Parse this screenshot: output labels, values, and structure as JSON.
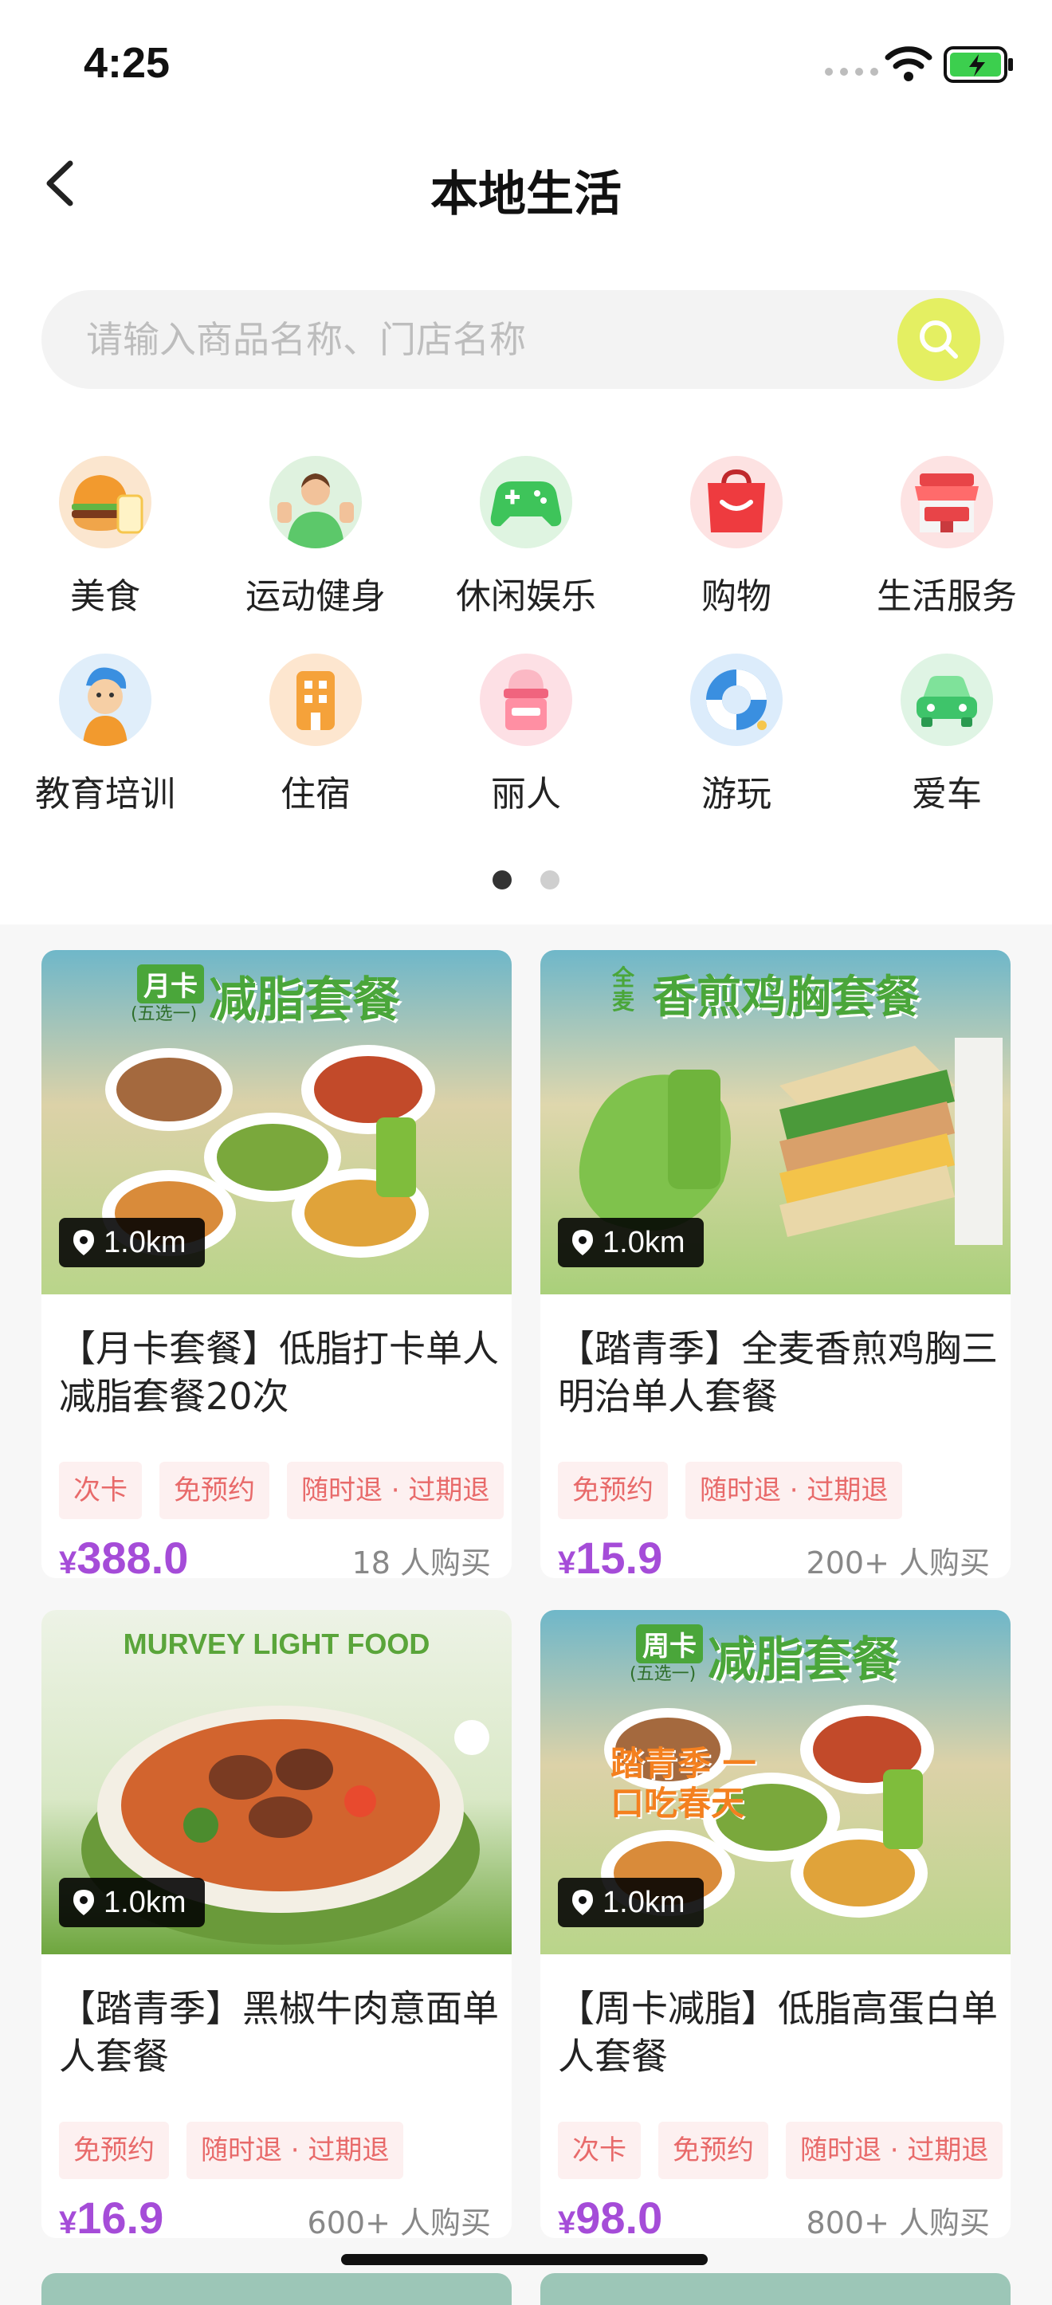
{
  "status_bar": {
    "time": "4:25"
  },
  "header": {
    "title": "本地生活"
  },
  "search": {
    "placeholder": "请输入商品名称、门店名称"
  },
  "categories": [
    {
      "label": "美食",
      "icon": "burger-icon"
    },
    {
      "label": "运动健身",
      "icon": "fitness-person-icon"
    },
    {
      "label": "休闲娱乐",
      "icon": "gamepad-icon"
    },
    {
      "label": "购物",
      "icon": "shopping-bag-icon"
    },
    {
      "label": "生活服务",
      "icon": "shop-icon"
    },
    {
      "label": "教育培训",
      "icon": "student-icon"
    },
    {
      "label": "住宿",
      "icon": "hotel-icon"
    },
    {
      "label": "丽人",
      "icon": "cosmetics-icon"
    },
    {
      "label": "游玩",
      "icon": "swim-ring-icon"
    },
    {
      "label": "爱车",
      "icon": "car-icon"
    }
  ],
  "pagination": {
    "pages": 2,
    "active": 1
  },
  "products": [
    {
      "banner_top": "月卡",
      "banner_sub": "(五选一)",
      "banner_title": "减脂套餐",
      "distance": "1.0km",
      "name": "【月卡套餐】低脂打卡单人减脂套餐20次",
      "tags": [
        "次卡",
        "免预约",
        "随时退 · 过期退"
      ],
      "price_symbol": "¥",
      "price": "388.0",
      "sold": "18 人购买"
    },
    {
      "banner_top": "全麦",
      "banner_sub": "",
      "banner_title": "香煎鸡胸套餐",
      "distance": "1.0km",
      "name": "【踏青季】全麦香煎鸡胸三明治单人套餐",
      "tags": [
        "免预约",
        "随时退 · 过期退"
      ],
      "price_symbol": "¥",
      "price": "15.9",
      "sold": "200+ 人购买"
    },
    {
      "banner_top": "",
      "banner_sub": "",
      "banner_title": "MURVEY LIGHT FOOD",
      "distance": "1.0km",
      "name": "【踏青季】黑椒牛肉意面单人套餐",
      "tags": [
        "免预约",
        "随时退 · 过期退"
      ],
      "price_symbol": "¥",
      "price": "16.9",
      "sold": "600+ 人购买"
    },
    {
      "banner_top": "周卡",
      "banner_sub": "(五选一)",
      "banner_title": "减脂套餐",
      "banner_overlay": "踏青季 一口吃春天",
      "distance": "1.0km",
      "name": "【周卡减脂】低脂高蛋白单人套餐",
      "tags": [
        "次卡",
        "免预约",
        "随时退 · 过期退"
      ],
      "price_symbol": "¥",
      "price": "98.0",
      "sold": "800+ 人购买"
    }
  ],
  "colors": {
    "accent_price": "#a54cd8",
    "search_button": "#e4ef62",
    "tag_text": "#e86a6a",
    "tag_bg": "#fdf0f0"
  }
}
